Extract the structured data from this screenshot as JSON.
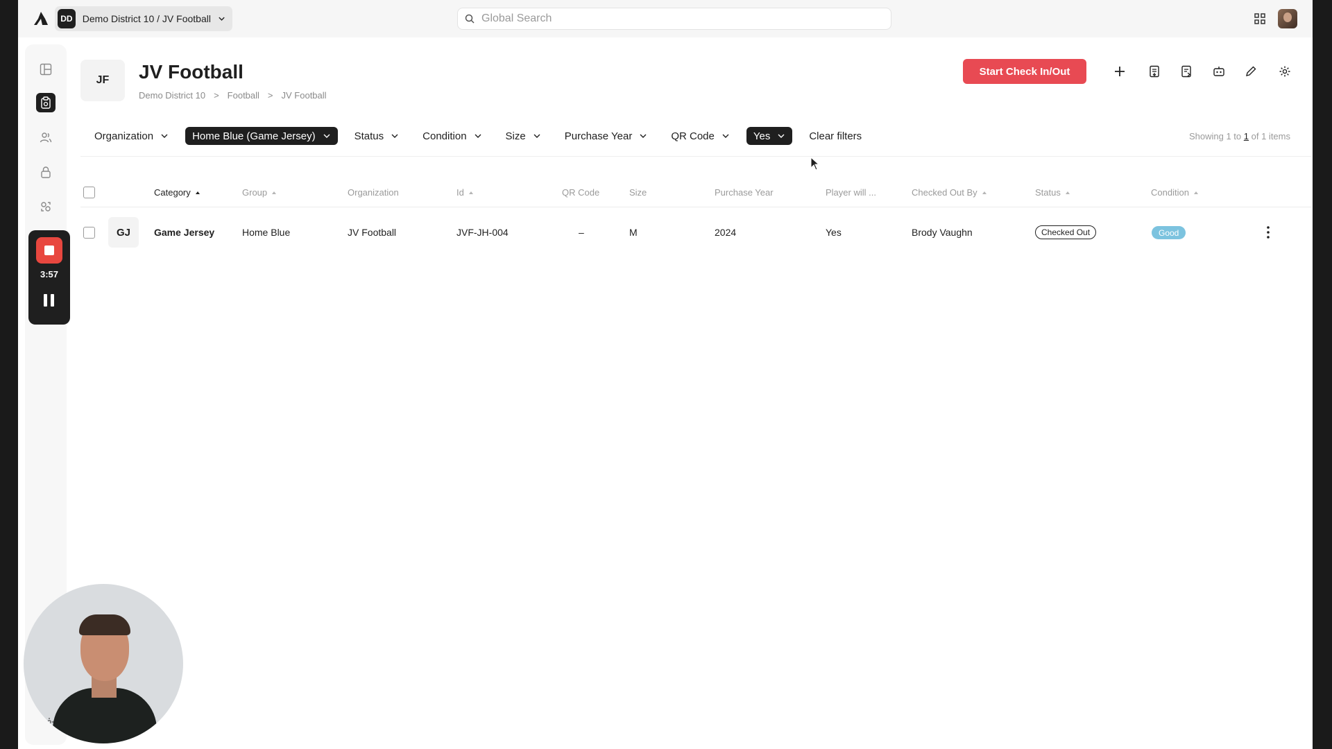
{
  "topbar": {
    "workspace_badge": "DD",
    "workspace_label": "Demo District 10 / JV Football",
    "search_placeholder": "Global Search"
  },
  "recorder": {
    "time": "3:57"
  },
  "header": {
    "team_initials": "JF",
    "title": "JV Football",
    "breadcrumb": [
      "Demo District 10",
      ">",
      "Football",
      ">",
      "JV Football"
    ],
    "start_button": "Start Check In/Out"
  },
  "filters": {
    "items": [
      "Organization",
      "Home Blue (Game Jersey)",
      "Status",
      "Condition",
      "Size",
      "Purchase Year",
      "QR Code",
      "Yes"
    ],
    "active": [
      false,
      true,
      false,
      false,
      false,
      false,
      false,
      true
    ],
    "clear_label": "Clear filters"
  },
  "pagination": {
    "prefix": "Showing 1 to",
    "page": "1",
    "suffix": "of 1 items"
  },
  "table": {
    "columns": [
      "Category",
      "Group",
      "Organization",
      "Id",
      "QR Code",
      "Size",
      "Purchase Year",
      "Player will ...",
      "Checked Out By",
      "Status",
      "Condition"
    ],
    "rows": [
      {
        "thumb": "GJ",
        "category": "Game Jersey",
        "group": "Home Blue",
        "organization": "JV Football",
        "id": "JVF-JH-004",
        "qr_code": "–",
        "size": "M",
        "purchase_year": "2024",
        "player_will": "Yes",
        "checked_out_by": "Brody Vaughn",
        "status": "Checked Out",
        "condition": "Good"
      }
    ]
  },
  "colors": {
    "accent": "#e84a53",
    "condition_good": "#7cc3df",
    "dark": "#1f1f1f"
  }
}
